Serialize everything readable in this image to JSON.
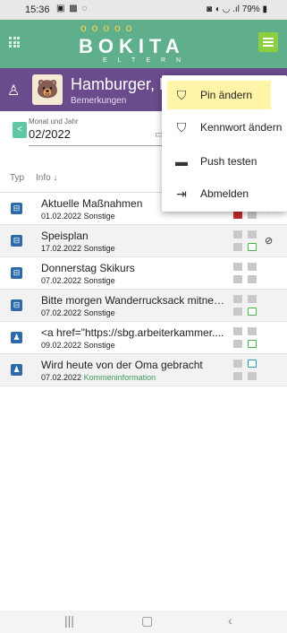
{
  "status": {
    "time": "15:36",
    "left_icons": "▣ ▩ ◌",
    "right_icons": "◙ ◖ ◡ .ıl",
    "battery": "79%"
  },
  "app": {
    "logo_faces": "ooooo",
    "logo_word": "BOKITA",
    "logo_sub": "ELTERN"
  },
  "profile": {
    "name": "Hamburger, P",
    "subtitle": "Bemerkungen"
  },
  "month": {
    "label": "Monat und Jahr",
    "value": "02/2022"
  },
  "table": {
    "col_type": "Typ",
    "col_info": "Info ↓",
    "rows": [
      {
        "title": "Aktuelle Maßnahmen",
        "date": "01.02.2022",
        "category": "Sonstige",
        "cat_color": ""
      },
      {
        "title": "Speisplan",
        "date": "17.02.2022",
        "category": "Sonstige",
        "cat_color": ""
      },
      {
        "title": "Donnerstag Skikurs",
        "date": "07.02.2022",
        "category": "Sonstige",
        "cat_color": ""
      },
      {
        "title": "Bitte morgen Wanderrucksack mitneh...",
        "date": "07.02.2022",
        "category": "Sonstige",
        "cat_color": ""
      },
      {
        "title": "<a href=\"https://sbg.arbeiterkammer....",
        "date": "09.02.2022",
        "category": "Sonstige",
        "cat_color": ""
      },
      {
        "title": "Wird heute von der Oma gebracht",
        "date": "07.02.2022",
        "category": "Kommeninformation",
        "cat_color": "green"
      }
    ]
  },
  "menu": {
    "items": [
      {
        "label": "Pin ändern",
        "icon": "shield-icon"
      },
      {
        "label": "Kennwort ändern",
        "icon": "shield-icon"
      },
      {
        "label": "Push testen",
        "icon": "chat-icon"
      },
      {
        "label": "Abmelden",
        "icon": "logout-icon"
      }
    ]
  },
  "colors": {
    "header_green": "#5fae8c",
    "profile_purple": "#6a4b8c",
    "menu_highlight": "#fff4a8",
    "type_icon_blue": "#2e6aa8"
  }
}
